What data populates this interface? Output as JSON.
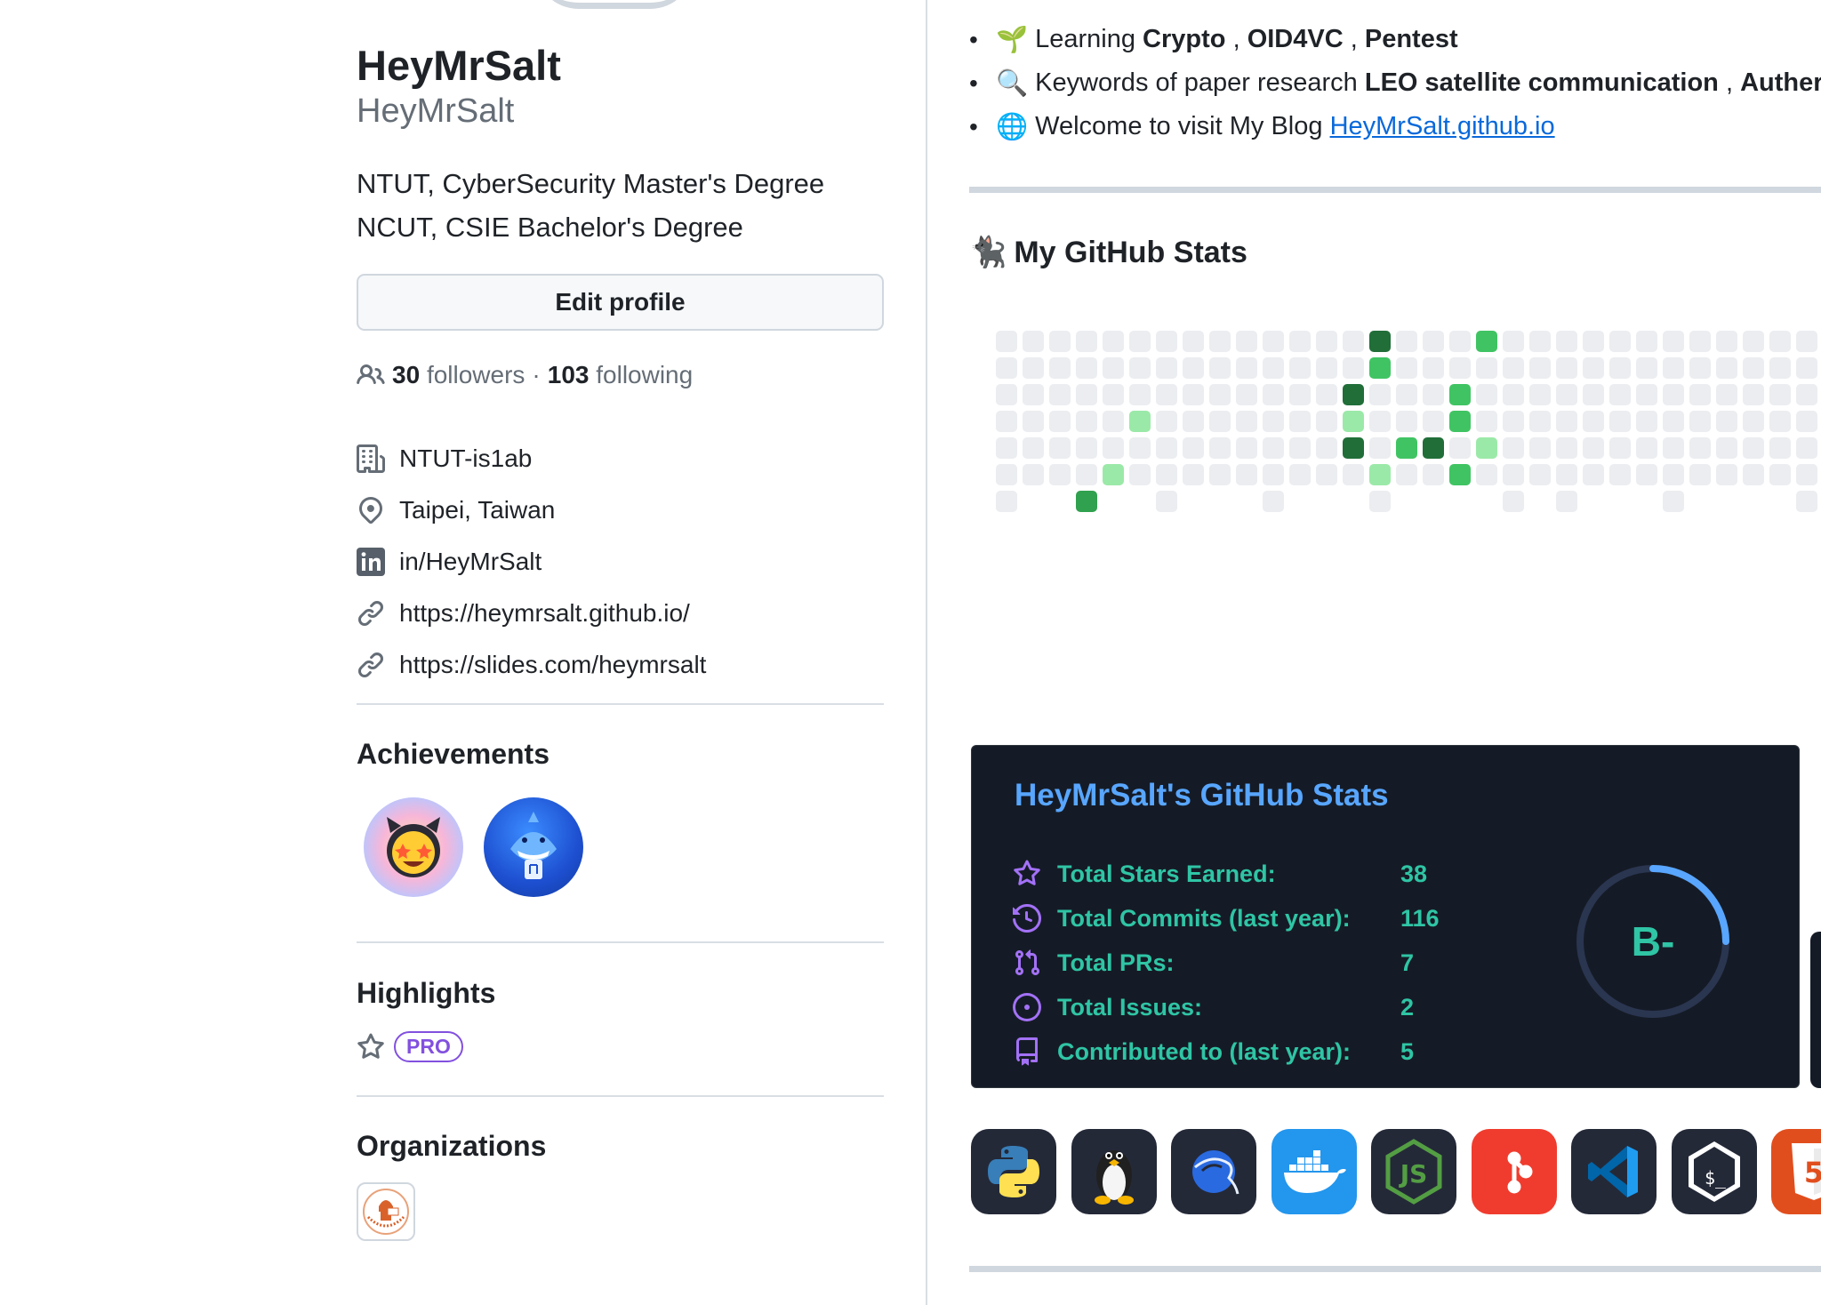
{
  "profile": {
    "display_name": "HeyMrSalt",
    "login": "HeyMrSalt",
    "bio_line1": "NTUT, CyberSecurity Master's Degree",
    "bio_line2": "NCUT, CSIE Bachelor's Degree",
    "edit_label": "Edit profile",
    "followers_count": "30",
    "followers_label": "followers",
    "separator": "·",
    "following_count": "103",
    "following_label": "following",
    "company": "NTUT-is1ab",
    "location": "Taipei, Taiwan",
    "linkedin": "in/HeyMrSalt",
    "link1": "https://heymrsalt.github.io/",
    "link2": "https://slides.com/heymrsalt"
  },
  "sections": {
    "achievements": "Achievements",
    "highlights": "Highlights",
    "pro": "PRO",
    "organizations": "Organizations"
  },
  "readme": {
    "line_learning_prefix": "Learning",
    "learn1": "Crypto",
    "learn_sep1": ",",
    "learn2": "OID4VC",
    "learn_sep2": ",",
    "learn3": "Pentest",
    "line_keywords_prefix": "Keywords of paper research",
    "keyword1": "LEO satellite communication",
    "keyword_sep": ",",
    "keyword2": "Auther",
    "line_blog_prefix": "Welcome to visit My Blog",
    "blog_link": "HeyMrSalt.github.io",
    "stats_heading": "My GitHub Stats"
  },
  "stats_card": {
    "title": "HeyMrSalt's GitHub Stats",
    "rows": [
      {
        "label": "Total Stars Earned:",
        "value": "38",
        "icon": "star-icon"
      },
      {
        "label": "Total Commits (last year):",
        "value": "116",
        "icon": "history-icon"
      },
      {
        "label": "Total PRs:",
        "value": "7",
        "icon": "pull-request-icon"
      },
      {
        "label": "Total Issues:",
        "value": "2",
        "icon": "issue-icon"
      },
      {
        "label": "Contributed to (last year):",
        "value": "5",
        "icon": "repo-icon"
      }
    ],
    "rank": "B-",
    "rank_progress": 0.25,
    "colors": {
      "bg": "#151b26",
      "title": "#58a6ff",
      "text": "#2fc5a5"
    }
  },
  "tech_icons": [
    "python-icon",
    "linux-icon",
    "kali-icon",
    "docker-icon",
    "nodejs-icon",
    "git-icon",
    "vscode-icon",
    "bash-icon",
    "html5-icon"
  ],
  "contribution_levels": {
    "empty": "#ebedf0",
    "l1": "#9be9a8",
    "l2": "#40c463",
    "l3": "#30a14e",
    "l4": "#216e39"
  }
}
